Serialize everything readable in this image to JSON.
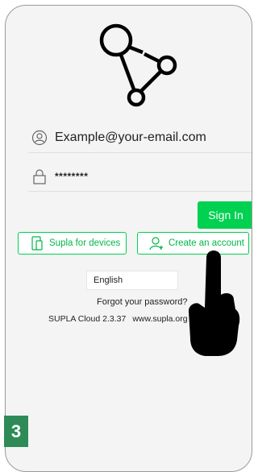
{
  "login": {
    "email_value": "Example@your-email.com",
    "password_value": "********",
    "signin_label": "Sign In"
  },
  "links": {
    "devices_label": "Supla for devices",
    "create_account_label": "Create an account"
  },
  "language": {
    "selected": "English"
  },
  "forgot_label": "Forgot your password?",
  "footer": {
    "version": "SUPLA Cloud 2.3.37",
    "site": "www.supla.org"
  },
  "step_badge": "3",
  "icons": {
    "logo": "supla-logo-icon",
    "email": "user-icon",
    "password": "lock-icon",
    "devices": "tablet-phone-icon",
    "create_account": "add-user-icon",
    "pointer": "hand-pointer-icon"
  },
  "colors": {
    "accent": "#00d151",
    "background": "#f4f4f4",
    "badge": "#2e8b57"
  }
}
